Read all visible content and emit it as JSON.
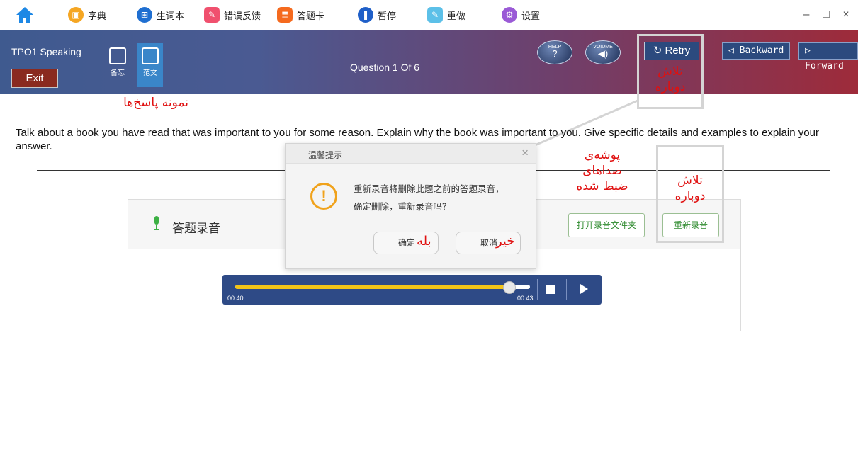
{
  "toolbar": {
    "items": [
      {
        "label": "字典",
        "icon": "dictionary-icon",
        "color": "#f5a623"
      },
      {
        "label": "生词本",
        "icon": "vocabulary-book-icon",
        "color": "#1f6fd1"
      },
      {
        "label": "错误反馈",
        "icon": "feedback-icon",
        "color": "#f0506e"
      },
      {
        "label": "答题卡",
        "icon": "answer-card-icon",
        "color": "#f56a1e"
      },
      {
        "label": "暂停",
        "icon": "pause-icon",
        "color": "#1f5fc8"
      },
      {
        "label": "重做",
        "icon": "redo-icon",
        "color": "#5cc0e8"
      },
      {
        "label": "设置",
        "icon": "settings-icon",
        "color": "#9a5ad6"
      }
    ],
    "window_controls": {
      "minimize": "–",
      "maximize": "□",
      "close": "×"
    }
  },
  "header": {
    "title": "TPO1 Speaking",
    "exit_label": "Exit",
    "tool_memo_label": "备忘",
    "tool_sample_label": "范文",
    "question_count": "Question 1 Of 6",
    "help_small": "HELP",
    "help_big": "?",
    "volume_small": "VOIUME",
    "volume_big": "◀)",
    "retry_label": "Retry",
    "backward_label": "Backward",
    "forward_label": "Forward"
  },
  "annotations": {
    "sample_answers": "نمونه پاسخ‌ها",
    "retry_line1": "تلاش",
    "retry_line2": "دوباره",
    "recordings_line1": "پوشه‌ی",
    "recordings_line2": "صداهای",
    "recordings_line3": "ضبط شده",
    "rerecord_line1": "تلاش",
    "rerecord_line2": "دوباره",
    "yes": "بله",
    "no": "خیر"
  },
  "prompt": "Talk about a book you have read that was important to you for some reason. Explain why the book was important to you. Give specific details and examples to explain your answer.",
  "recording": {
    "title": "答题录音",
    "open_folder_label": "打开录音文件夹",
    "rerecord_label": "重新录音",
    "player": {
      "current_time": "00:40",
      "total_time": "00:43",
      "progress": 0.93
    }
  },
  "dialog": {
    "title": "温馨提示",
    "close": "×",
    "icon": "!",
    "message_line1": "重新录音将删除此题之前的答题录音，",
    "message_line2": "确定删除，重新录音吗？",
    "confirm_label": "确定",
    "cancel_label": "取消"
  }
}
